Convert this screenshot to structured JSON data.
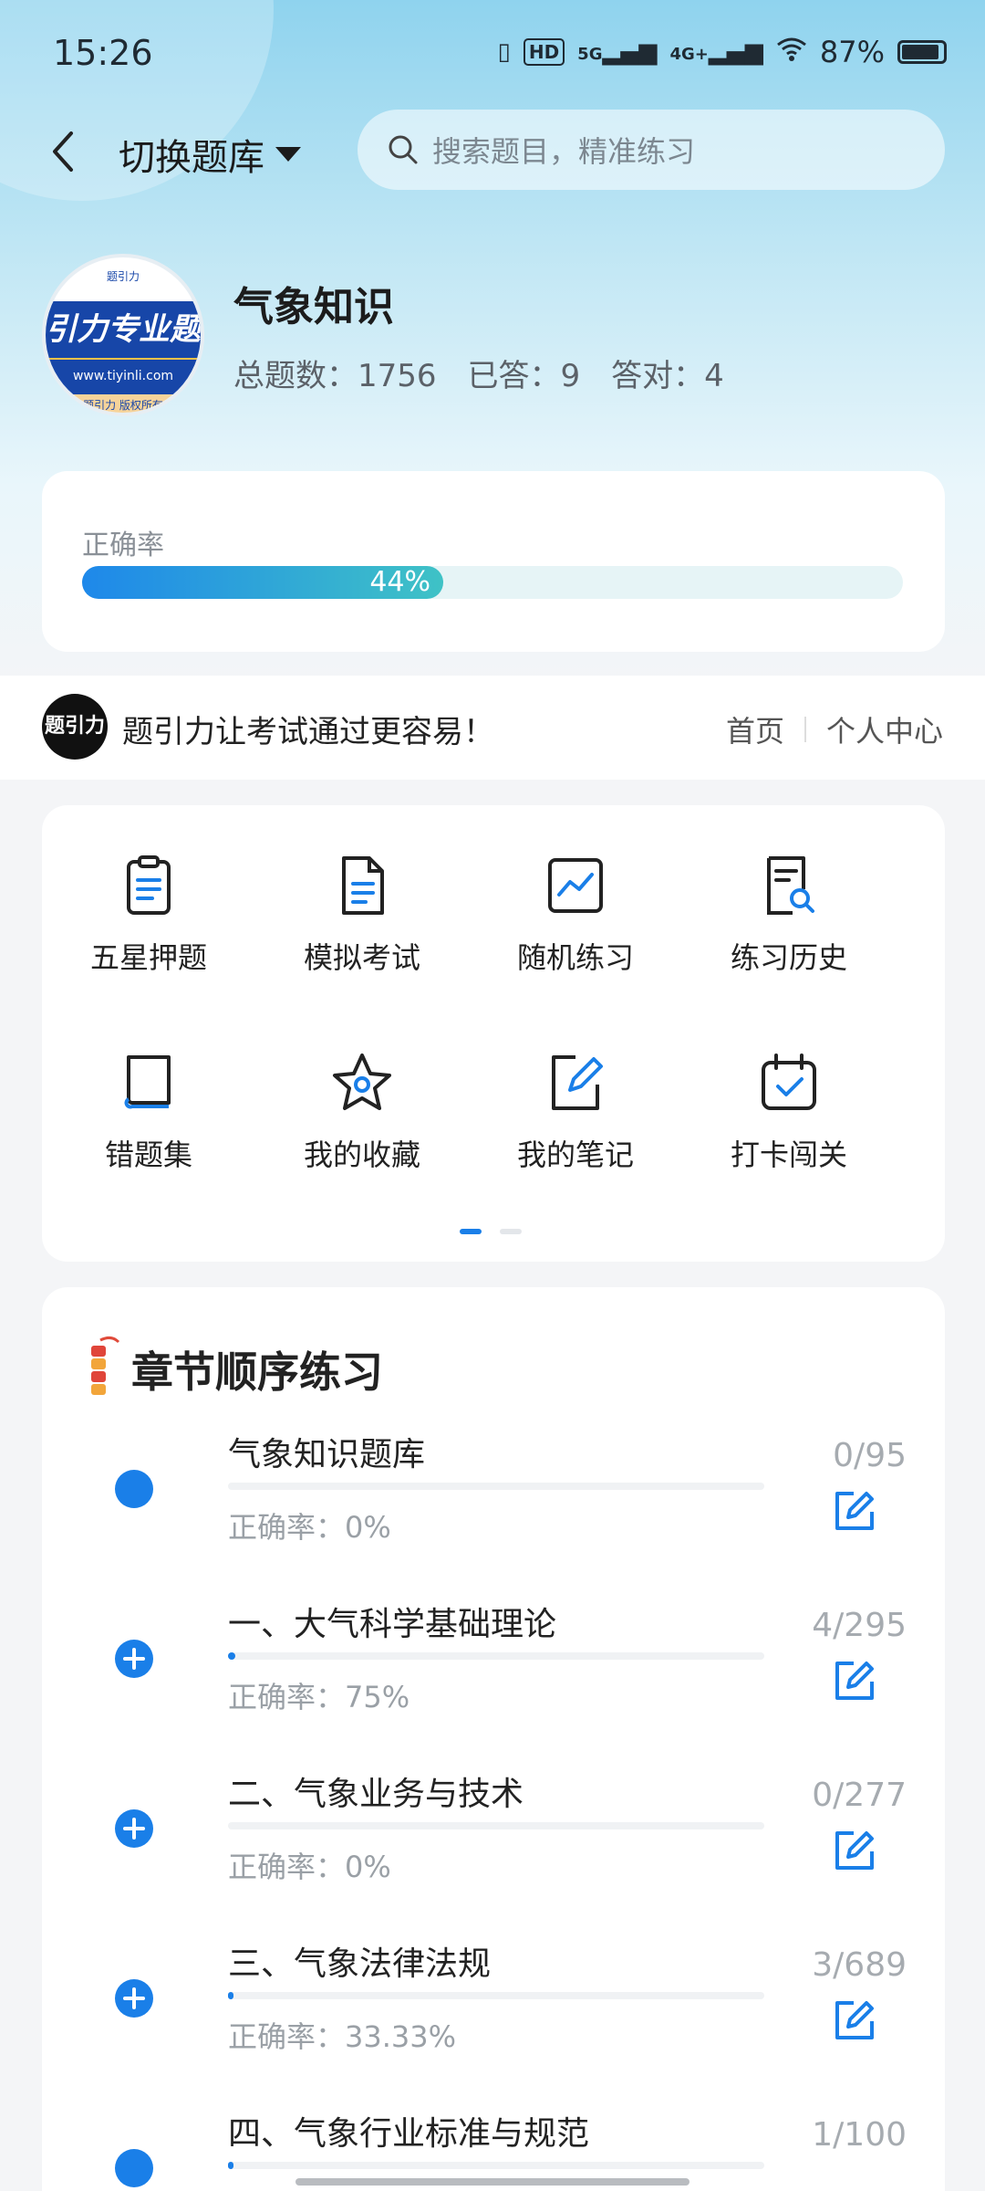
{
  "status_bar": {
    "time": "15:26",
    "battery": "87%",
    "hd": "HD",
    "sig5g": "5G",
    "sig4g": "4G+"
  },
  "nav": {
    "switch_label": "切换题库",
    "search_placeholder": "搜索题目，精准练习"
  },
  "bank": {
    "logo_text": "引力专业题",
    "logo_url": "www.tiyinli.com",
    "logo_copyright": "题引力 版权所有",
    "title": "气象知识",
    "total": "总题数：1756",
    "answered": "已答：9",
    "correct": "答对：4"
  },
  "accuracy": {
    "label": "正确率",
    "value_text": "44%",
    "value": 0.44
  },
  "banner": {
    "logo_text": "题引力",
    "slogan": "题引力让考试通过更容易！",
    "link_home": "首页",
    "link_profile": "个人中心"
  },
  "features": [
    {
      "label": "五星押题",
      "icon": "clipboard-icon"
    },
    {
      "label": "模拟考试",
      "icon": "document-icon"
    },
    {
      "label": "随机练习",
      "icon": "chart-icon"
    },
    {
      "label": "练习历史",
      "icon": "history-search-icon"
    },
    {
      "label": "错题集",
      "icon": "book-icon"
    },
    {
      "label": "我的收藏",
      "icon": "star-icon"
    },
    {
      "label": "我的笔记",
      "icon": "note-edit-icon"
    },
    {
      "label": "打卡闯关",
      "icon": "calendar-check-icon"
    }
  ],
  "chapters": {
    "title": "章节顺序练习",
    "items": [
      {
        "name": "气象知识题库",
        "rate": "正确率：0%",
        "count": "0/95",
        "progress": 0.0,
        "expandable": false
      },
      {
        "name": "一、大气科学基础理论",
        "rate": "正确率：75%",
        "count": "4/295",
        "progress": 0.0136,
        "expandable": true
      },
      {
        "name": "二、气象业务与技术",
        "rate": "正确率：0%",
        "count": "0/277",
        "progress": 0.0,
        "expandable": true
      },
      {
        "name": "三、气象法律法规",
        "rate": "正确率：33.33%",
        "count": "3/689",
        "progress": 0.0044,
        "expandable": true
      },
      {
        "name": "四、气象行业标准与规范",
        "rate": "",
        "count": "1/100",
        "progress": 0.01,
        "expandable": false
      }
    ]
  },
  "colors": {
    "primary": "#1a7fe8",
    "accent": "#3fc2c6"
  }
}
